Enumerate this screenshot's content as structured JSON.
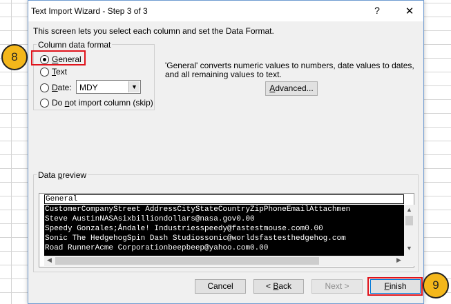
{
  "window": {
    "title": "Text Import Wizard - Step 3 of 3",
    "help_glyph": "?",
    "close_glyph": "✕"
  },
  "intro_text": "This screen lets you select each column and set the Data Format.",
  "column_format": {
    "group_label": "Column data format",
    "options": {
      "general": {
        "label_underlined": "G",
        "label_rest": "eneral",
        "checked": true
      },
      "text": {
        "label_underlined": "T",
        "label_rest": "ext",
        "checked": false
      },
      "date": {
        "label_underlined": "D",
        "label_rest": "ate:",
        "checked": false
      },
      "skip": {
        "label_before": "Do ",
        "label_underlined": "n",
        "label_rest": "ot import column (skip)",
        "checked": false
      }
    },
    "date_format_value": "MDY",
    "dropdown_glyph": "▼"
  },
  "description": "'General' converts numeric values to numbers, date values to dates, and all remaining values to text.",
  "advanced_button": {
    "label_underlined": "A",
    "label_rest": "dvanced..."
  },
  "data_preview": {
    "label_before": "Data ",
    "label_underlined": "p",
    "label_rest": "review",
    "column_header": "General",
    "rows": [
      "CustomerCompanyStreet AddressCityStateCountryZipPhoneEmailAttachmen",
      "Steve AustinNASAsixbilliondollars@nasa.gov0.00",
      "Speedy Gonzales;Ándale! Industriesspeedy@fastestmouse.com0.00",
      "Sonic The HedgehogSpin Dash Studiossonic@worldsfastesthedgehog.com",
      "Road RunnerAcme Corporationbeepbeep@yahoo.com0.00"
    ],
    "scroll_up_glyph": "▲",
    "scroll_down_glyph": "▼",
    "scroll_left_glyph": "◀",
    "scroll_right_glyph": "▶"
  },
  "buttons": {
    "cancel": "Cancel",
    "back_prefix": "< ",
    "back_underlined": "B",
    "back_rest": "ack",
    "next": "Next >",
    "finish_underlined": "F",
    "finish_rest": "inish"
  },
  "markers": {
    "step_8": "8",
    "step_9": "9"
  },
  "colors": {
    "highlight_red": "#e0131b",
    "marker_yellow": "#f4b71b",
    "preview_background": "#000000"
  }
}
